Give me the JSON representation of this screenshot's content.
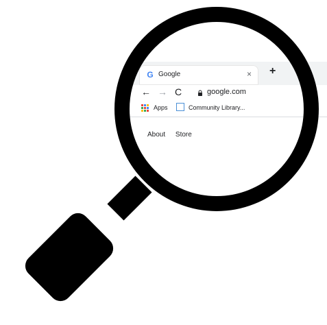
{
  "browser": {
    "tab": {
      "title": "Google",
      "close_label": "×"
    },
    "new_tab_label": "+",
    "toolbar": {
      "back_label": "←",
      "forward_label": "→",
      "reload_label": "C",
      "url": "google.com"
    },
    "bookmarks": {
      "apps_label": "Apps",
      "library_label": "Community Library..."
    },
    "page": {
      "links": [
        {
          "label": "About"
        },
        {
          "label": "Store"
        }
      ]
    }
  },
  "icons": {
    "magnifier": "magnifying-glass-icon",
    "google": "google-icon",
    "lock": "lock-icon",
    "apps": "apps-grid-icon",
    "library": "library-icon"
  },
  "colors": {
    "google_blue": "#4285f4",
    "google_red": "#ea4335",
    "google_yellow": "#fbbc05",
    "google_green": "#34a853",
    "lens": "#000000",
    "library_blue": "#4a8fd6"
  }
}
